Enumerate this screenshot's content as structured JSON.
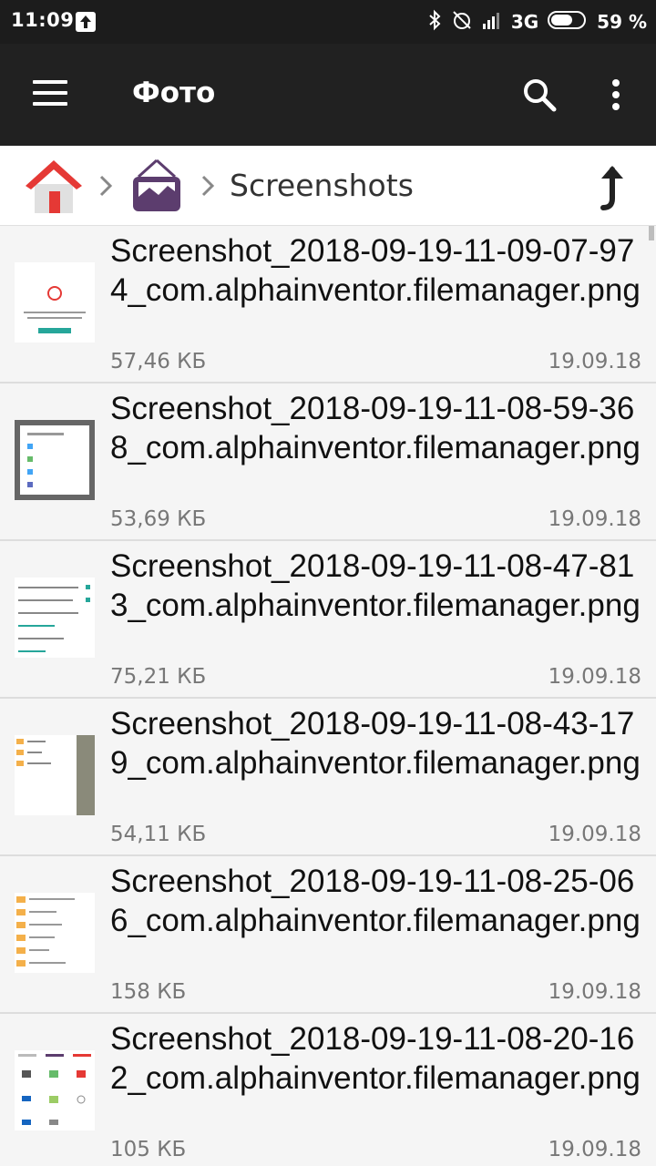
{
  "status_bar": {
    "time": "11:09",
    "network": "3G",
    "battery": "59 %"
  },
  "app_bar": {
    "title": "Фото",
    "icons": [
      "menu-icon",
      "search-icon",
      "more-vertical-icon"
    ]
  },
  "breadcrumb": {
    "icons": [
      "home-icon",
      "gallery-icon"
    ],
    "current": "Screenshots"
  },
  "files": [
    {
      "name": "Screenshot_2018-09-19-11-09-07-974_com.alphainventor.filemanager.png",
      "size": "57,46 КБ",
      "date": "19.09.18"
    },
    {
      "name": "Screenshot_2018-09-19-11-08-59-368_com.alphainventor.filemanager.png",
      "size": "53,69 КБ",
      "date": "19.09.18"
    },
    {
      "name": "Screenshot_2018-09-19-11-08-47-813_com.alphainventor.filemanager.png",
      "size": "75,21 КБ",
      "date": "19.09.18"
    },
    {
      "name": "Screenshot_2018-09-19-11-08-43-179_com.alphainventor.filemanager.png",
      "size": "54,11 КБ",
      "date": "19.09.18"
    },
    {
      "name": "Screenshot_2018-09-19-11-08-25-066_com.alphainventor.filemanager.png",
      "size": "158 КБ",
      "date": "19.09.18"
    },
    {
      "name": "Screenshot_2018-09-19-11-08-20-162_com.alphainventor.filemanager.png",
      "size": "105 КБ",
      "date": "19.09.18"
    }
  ],
  "colors": {
    "app_bar": "#212121",
    "status_bar": "#1c1c1c",
    "home_roof": "#e53935",
    "gallery": "#5c3d6e"
  }
}
